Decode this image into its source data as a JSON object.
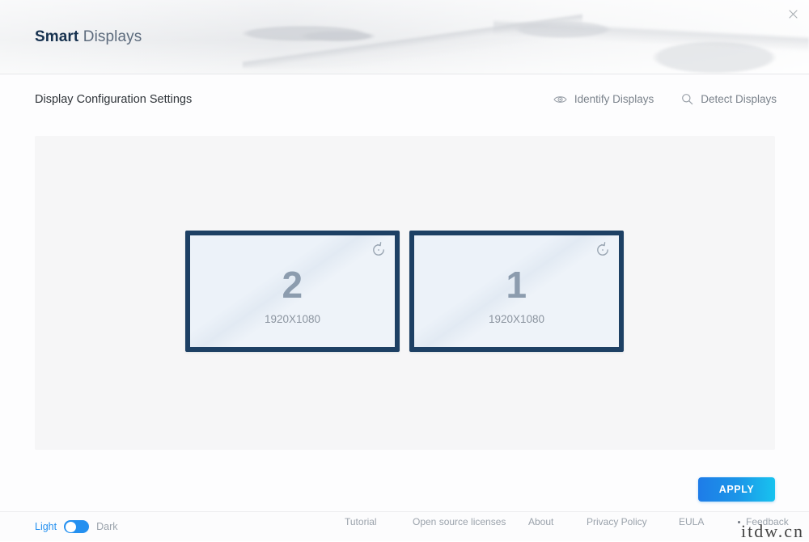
{
  "window": {
    "close_label": "✕"
  },
  "header": {
    "brand_strong": "Smart",
    "brand_light": "Displays"
  },
  "subheader": {
    "page_title": "Display Configuration Settings",
    "actions": [
      {
        "label": "Identify Displays",
        "icon": "eye-icon"
      },
      {
        "label": "Detect Displays",
        "icon": "search-icon"
      }
    ]
  },
  "displays": [
    {
      "number": "2",
      "resolution": "1920X1080",
      "rotate_icon": "rotate-ccw-icon",
      "border_color": "#1d4064"
    },
    {
      "number": "1",
      "resolution": "1920X1080",
      "rotate_icon": "rotate-ccw-icon",
      "border_color": "#1d4064"
    }
  ],
  "apply": {
    "label": "APPLY",
    "gradient_start": "#1e7ce8",
    "gradient_end": "#18c3ef"
  },
  "footer": {
    "theme": {
      "light_label": "Light",
      "dark_label": "Dark",
      "selected": "Light",
      "accent": "#2490f0"
    },
    "links": [
      {
        "label": "Tutorial"
      },
      {
        "label": "Open source licenses"
      },
      {
        "label": "About"
      },
      {
        "label": "Privacy Policy"
      },
      {
        "label": "EULA"
      },
      {
        "label": "Feedback"
      }
    ]
  },
  "watermark": {
    "text": "itdw.cn"
  }
}
